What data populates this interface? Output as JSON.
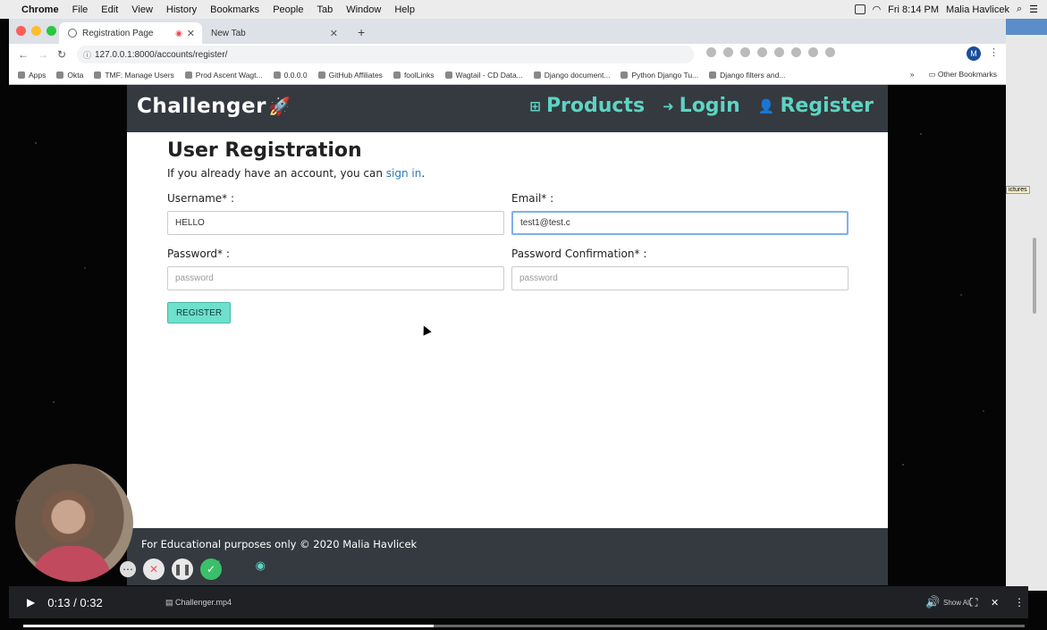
{
  "menubar": {
    "items": [
      "Chrome",
      "File",
      "Edit",
      "View",
      "History",
      "Bookmarks",
      "People",
      "Tab",
      "Window",
      "Help"
    ],
    "clock": "Fri 8:14 PM",
    "user": "Malia Havlicek"
  },
  "browser": {
    "tabs": [
      {
        "title": "Registration Page"
      },
      {
        "title": "New Tab"
      }
    ],
    "url": "127.0.0.1:8000/accounts/register/",
    "profile_initial": "M",
    "bookmarks": [
      "Apps",
      "Okta",
      "TMF: Manage Users",
      "Prod Ascent Wagt...",
      "0.0.0.0",
      "GitHub Affiliates",
      "foolLinks",
      "Wagtail - CD Data...",
      "Django document...",
      "Python Django Tu...",
      "Django filters and..."
    ],
    "other_bookmarks": "Other Bookmarks",
    "more_bookmarks": "»"
  },
  "site": {
    "brand": "Challenger",
    "nav": [
      {
        "label": "Products",
        "icon": "sitemap-icon"
      },
      {
        "label": "Login",
        "icon": "sign-in-icon"
      },
      {
        "label": "Register",
        "icon": "user-plus-icon"
      }
    ],
    "heading": "User Registration",
    "lead_prefix": "If you already have an account, you can ",
    "lead_link": "sign in",
    "lead_suffix": ".",
    "form": {
      "username_label": "Username* :",
      "username_value": "HELLO",
      "email_label": "Email* :",
      "email_value": "test1@test.c",
      "password_label": "Password* :",
      "password_placeholder": "password",
      "password_confirm_label": "Password Confirmation* :",
      "password_confirm_placeholder": "password",
      "submit_label": "REGISTER"
    },
    "footer": {
      "copyright": "For Educational purposes only © 2020 Malia Havlicek"
    }
  },
  "video": {
    "time": "0:13 / 0:32",
    "progress": 0.41,
    "download_file": "Challenger.mp4",
    "show_all": "Show All"
  },
  "colors": {
    "navbar_bg": "#343a40",
    "accent": "#5ed4c2",
    "button_bg": "#6ee0cc",
    "link": "#2a7ab9"
  }
}
